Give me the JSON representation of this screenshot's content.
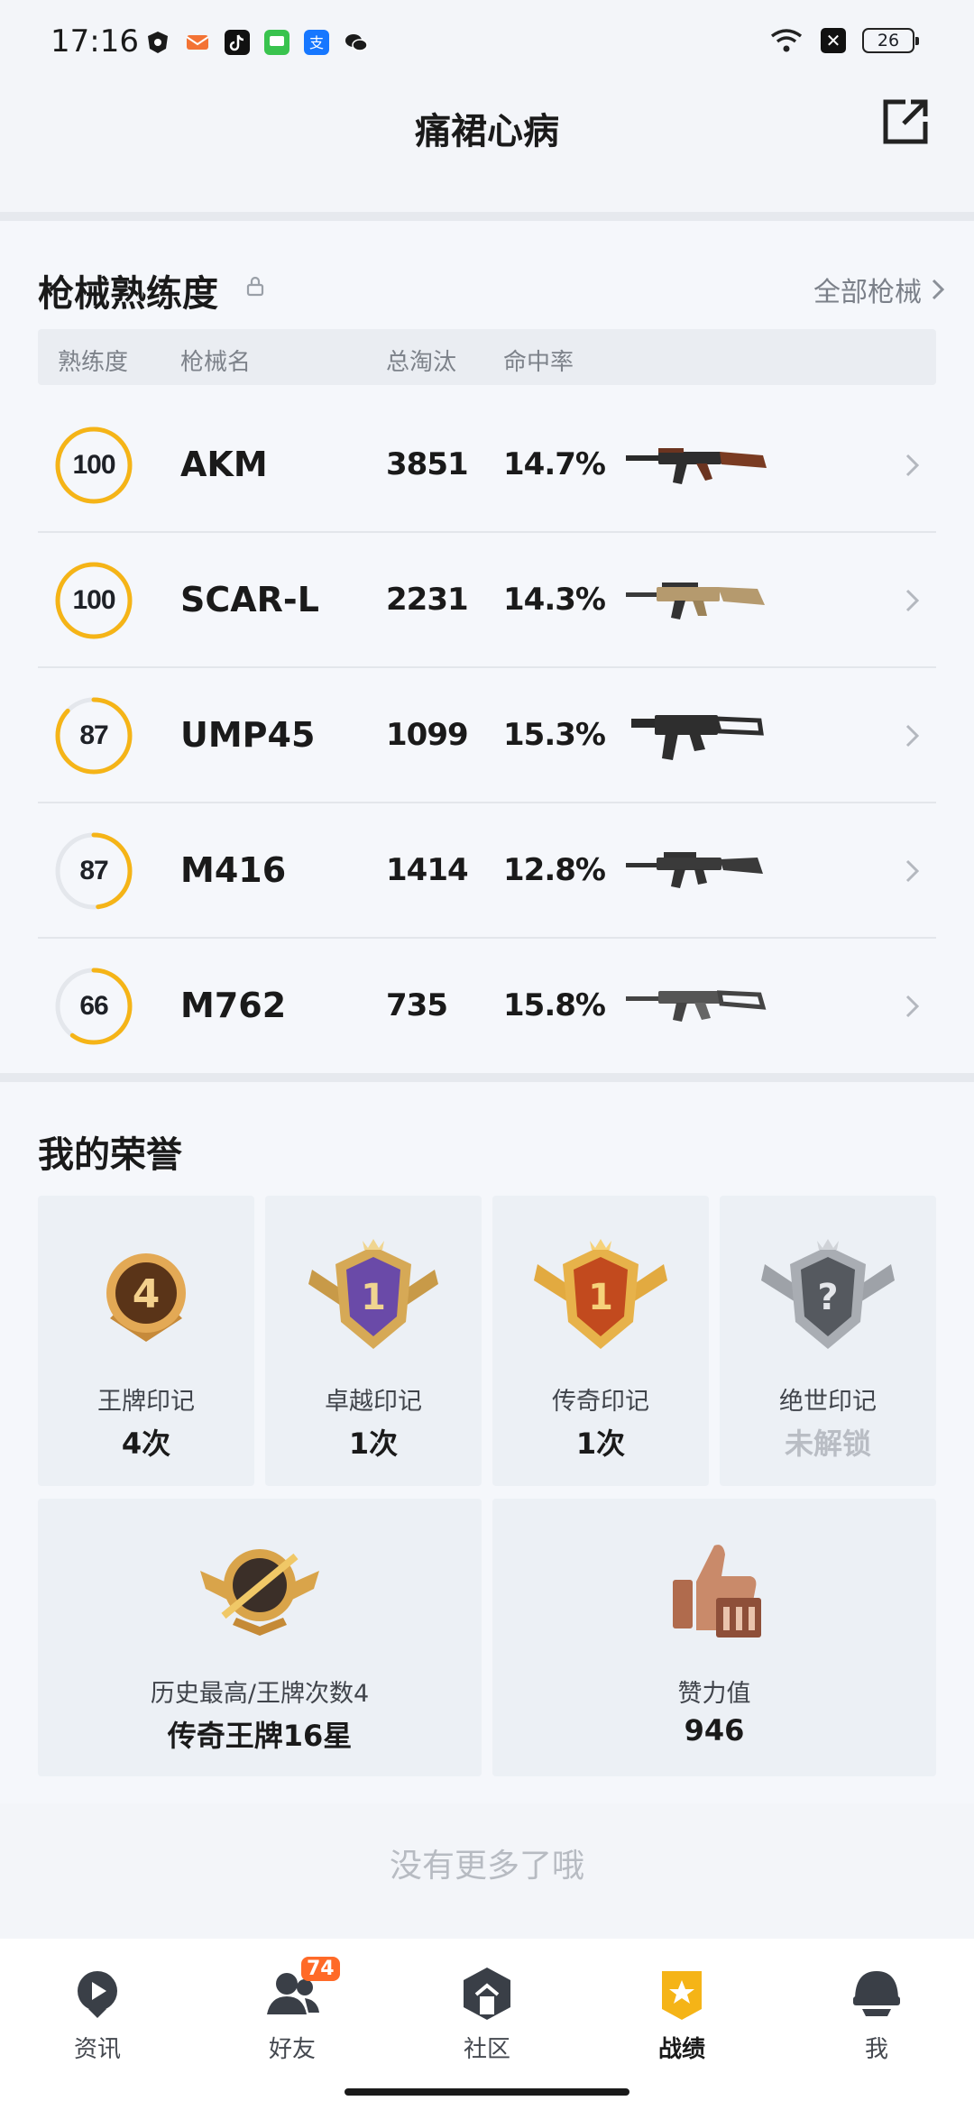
{
  "status_bar": {
    "time": "17:16",
    "battery": "26",
    "xbox_glyph": "✕",
    "apps": [
      "shield-app-icon",
      "mail-app-icon",
      "tiktok-app-icon",
      "messages-app-icon",
      "alipay-app-icon",
      "wechat-app-icon"
    ]
  },
  "header": {
    "title": "痛裙心病",
    "share_icon": "share-external-icon"
  },
  "weapons_section": {
    "title": "枪械熟练度",
    "all_link": "全部枪械",
    "columns": [
      "熟练度",
      "枪械名",
      "总淘汰",
      "命中率"
    ],
    "rows": [
      {
        "level": "100",
        "name": "AKM",
        "kills": "3851",
        "accuracy": "14.7%",
        "progress": 1.0
      },
      {
        "level": "100",
        "name": "SCAR-L",
        "kills": "2231",
        "accuracy": "14.3%",
        "progress": 1.0
      },
      {
        "level": "87",
        "name": "UMP45",
        "kills": "1099",
        "accuracy": "15.3%",
        "progress": 0.87
      },
      {
        "level": "87",
        "name": "M416",
        "kills": "1414",
        "accuracy": "12.8%",
        "progress": 0.48
      },
      {
        "level": "66",
        "name": "M762",
        "kills": "735",
        "accuracy": "15.8%",
        "progress": 0.6
      }
    ]
  },
  "honor_section": {
    "title": "我的荣誉",
    "badges": [
      {
        "name": "王牌印记",
        "value": "4次",
        "badge_number": "4"
      },
      {
        "name": "卓越印记",
        "value": "1次",
        "badge_number": "1"
      },
      {
        "name": "传奇印记",
        "value": "1次",
        "badge_number": "1"
      },
      {
        "name": "绝世印记",
        "value": "未解锁",
        "badge_number": "?"
      }
    ],
    "history": {
      "name": "历史最高/王牌次数4",
      "value": "传奇王牌16星"
    },
    "effort": {
      "name": "赞力值",
      "value": "946"
    }
  },
  "footer_text": "没有更多了哦",
  "tabbar": {
    "tabs": [
      {
        "label": "资讯",
        "icon": "news-icon"
      },
      {
        "label": "好友",
        "icon": "friends-icon",
        "badge": "74"
      },
      {
        "label": "社区",
        "icon": "community-icon"
      },
      {
        "label": "战绩",
        "icon": "records-icon",
        "active": true
      },
      {
        "label": "我",
        "icon": "profile-icon"
      }
    ]
  },
  "colors": {
    "accent": "#f5b417",
    "ring_track": "#e4e7ec",
    "badge": "#ff6a28"
  }
}
